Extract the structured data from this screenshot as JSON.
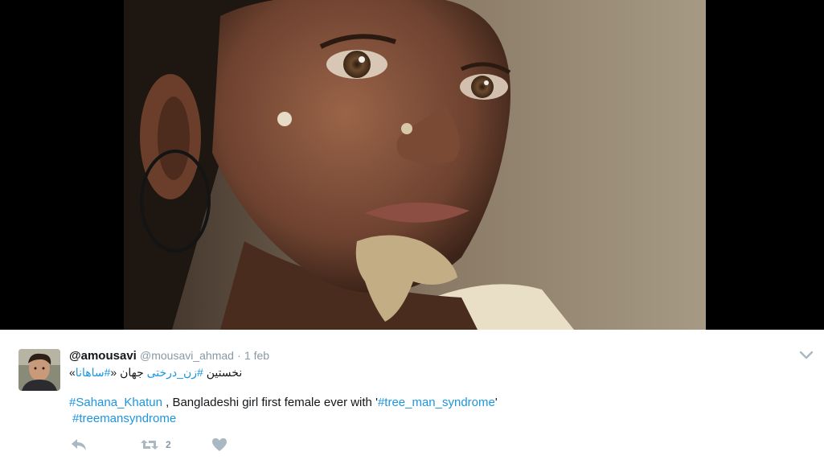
{
  "tweet": {
    "display_name": "@amousavi",
    "handle": "@mousavi_ahmad",
    "separator": "·",
    "timestamp": "1 feb",
    "persian_line": {
      "word_first": "نخستین",
      "hashtag_1": "#زن_درختی",
      "word_world": "جهان",
      "quote_open": "«",
      "hashtag_2": "#ساهانا",
      "quote_close": "»"
    },
    "english_line": {
      "hashtag_name": "#Sahana_Khatun",
      "text": " , Bangladeshi girl first female ever with '",
      "hashtag_syndrome": "#tree_man_syndrome",
      "text_end": "'"
    },
    "final_hashtag": "#treemansyndrome",
    "actions": {
      "retweet_count": "2"
    }
  },
  "colors": {
    "link": "#1b95e0",
    "text": "#14171a",
    "muted": "#8899a6",
    "icon": "#aab8c2",
    "media_background": "#000000"
  },
  "icons": [
    "reply-icon",
    "retweet-icon",
    "like-icon",
    "chevron-down-icon"
  ]
}
